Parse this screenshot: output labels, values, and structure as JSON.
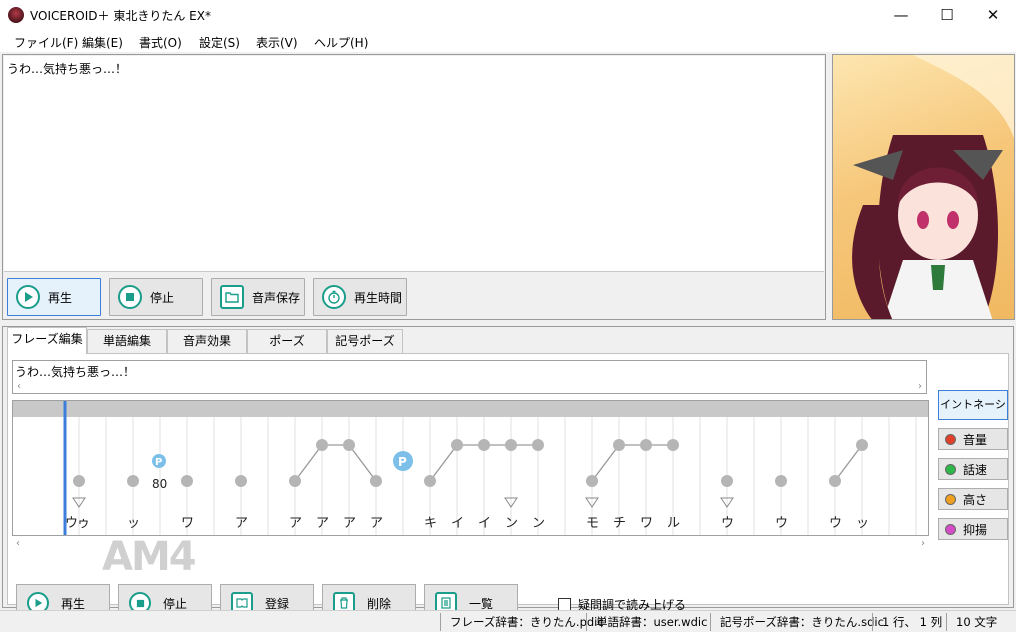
{
  "window": {
    "title": "VOICEROID＋ 東北きりたん EX*",
    "minimize": "—",
    "maximize": "☐",
    "close": "✕"
  },
  "menu": [
    "ファイル(F)",
    "編集(E)",
    "書式(O)",
    "設定(S)",
    "表示(V)",
    "ヘルプ(H)"
  ],
  "main_text": "うわ…気持ち悪っ…！",
  "main_buttons": {
    "play": "再生",
    "stop": "停止",
    "save": "音声保存",
    "duration": "再生時間"
  },
  "tabs": [
    "フレーズ編集",
    "単語編集",
    "音声効果",
    "ポーズ",
    "記号ポーズ"
  ],
  "active_tab": 0,
  "phrase_text": "うわ…気持ち悪っ…！",
  "kana": [
    "ウ",
    "ゥ",
    "ッ",
    "ワ",
    "ア",
    "ア",
    "ア",
    "ア",
    "ア",
    "キ",
    "イ",
    "イ",
    "ン",
    "ン",
    "モ",
    "チ",
    "ワ",
    "ル",
    "ウ",
    "ウ",
    "ウ",
    "ッ"
  ],
  "pause_value": "80",
  "pause_marker": "P",
  "side_buttons": {
    "intonation": "イントネーション",
    "volume": "音量",
    "speed": "話速",
    "pitch": "高さ",
    "emphasis": "抑揚"
  },
  "side_colors": {
    "volume": "#e0402a",
    "speed": "#2fb84a",
    "pitch": "#f0a020",
    "emphasis": "#d64cc8"
  },
  "lower_buttons": {
    "play": "再生",
    "stop": "停止",
    "register": "登録",
    "delete": "削除",
    "list": "一覧"
  },
  "question_reading": "疑問調で読み上げる",
  "status": {
    "phrase_dict": "フレーズ辞書：きりたん.pdic",
    "word_dict": "単語辞書：user.wdic",
    "symbol_dict": "記号ポーズ辞書：きりたん.sdic",
    "position": "1 行、 1 列",
    "chars": "10 文字"
  },
  "watermark": "AM4",
  "accent_color": "#1a9d8a"
}
